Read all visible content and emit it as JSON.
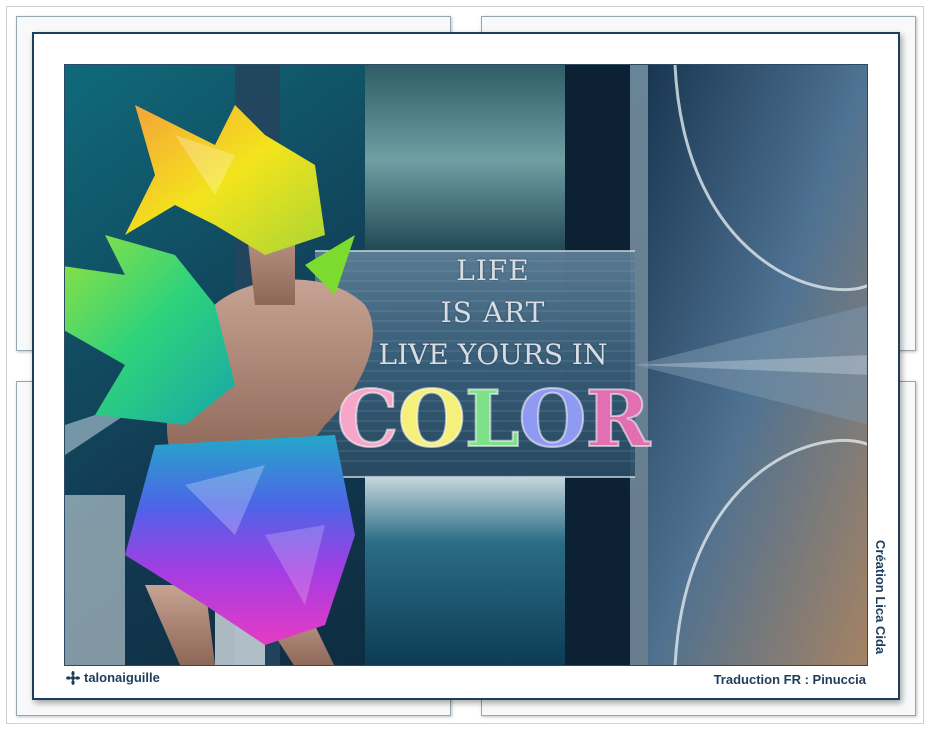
{
  "artwork": {
    "lines": [
      "LIFE",
      "IS ART",
      "LIVE YOURS IN"
    ],
    "color_letters": [
      {
        "char": "C",
        "color": "#f6a6c8"
      },
      {
        "char": "O",
        "color": "#f5f07a"
      },
      {
        "char": "L",
        "color": "#7ee089"
      },
      {
        "char": "O",
        "color": "#8f9bf2"
      },
      {
        "char": "R",
        "color": "#e36fb3"
      }
    ]
  },
  "credits": {
    "left": "talonaiguille",
    "right": "Traduction FR : Pinuccia",
    "vertical": "Création Lica Cida"
  },
  "colors": {
    "frame_dark": "#1f3e5c",
    "background_teal": "#0b2638",
    "credit_text": "#1d3d5a"
  },
  "icons": {
    "left_credit": "star-flower-icon"
  }
}
